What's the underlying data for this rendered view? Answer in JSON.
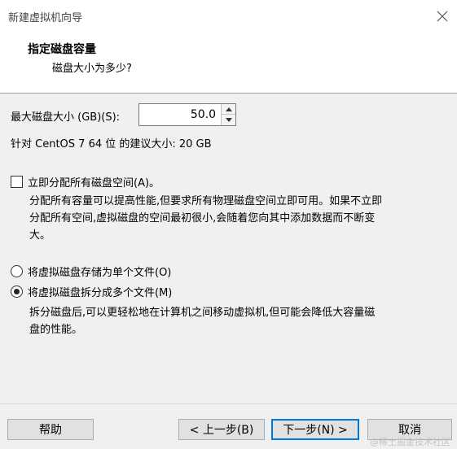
{
  "window": {
    "title": "新建虚拟机向导"
  },
  "header": {
    "title": "指定磁盘容量",
    "subtitle": "磁盘大小为多少?"
  },
  "disk_size": {
    "label": "最大磁盘大小 (GB)(S):",
    "value": "50.0",
    "recommend_text": "针对 CentOS 7 64 位 的建议大小: 20 GB"
  },
  "allocate": {
    "checkbox_label": "立即分配所有磁盘空间(A)。",
    "checked": false,
    "description_line1": "分配所有容量可以提高性能,但要求所有物理磁盘空间立即可用。如果不立即",
    "description_line2": "分配所有空间,虚拟磁盘的空间最初很小,会随着您向其中添加数据而不断变",
    "description_line3": "大。"
  },
  "storage": {
    "option_single": "将虚拟磁盘存储为单个文件(O)",
    "option_multiple": "将虚拟磁盘拆分成多个文件(M)",
    "selected": "multiple",
    "description_line1": "拆分磁盘后,可以更轻松地在计算机之间移动虚拟机,但可能会降低大容量磁",
    "description_line2": "盘的性能。"
  },
  "footer": {
    "help": "帮助",
    "back": "< 上一步(B)",
    "next": "下一步(N) >",
    "cancel": "取消"
  },
  "watermark": "@稀土掘金技术社区"
}
